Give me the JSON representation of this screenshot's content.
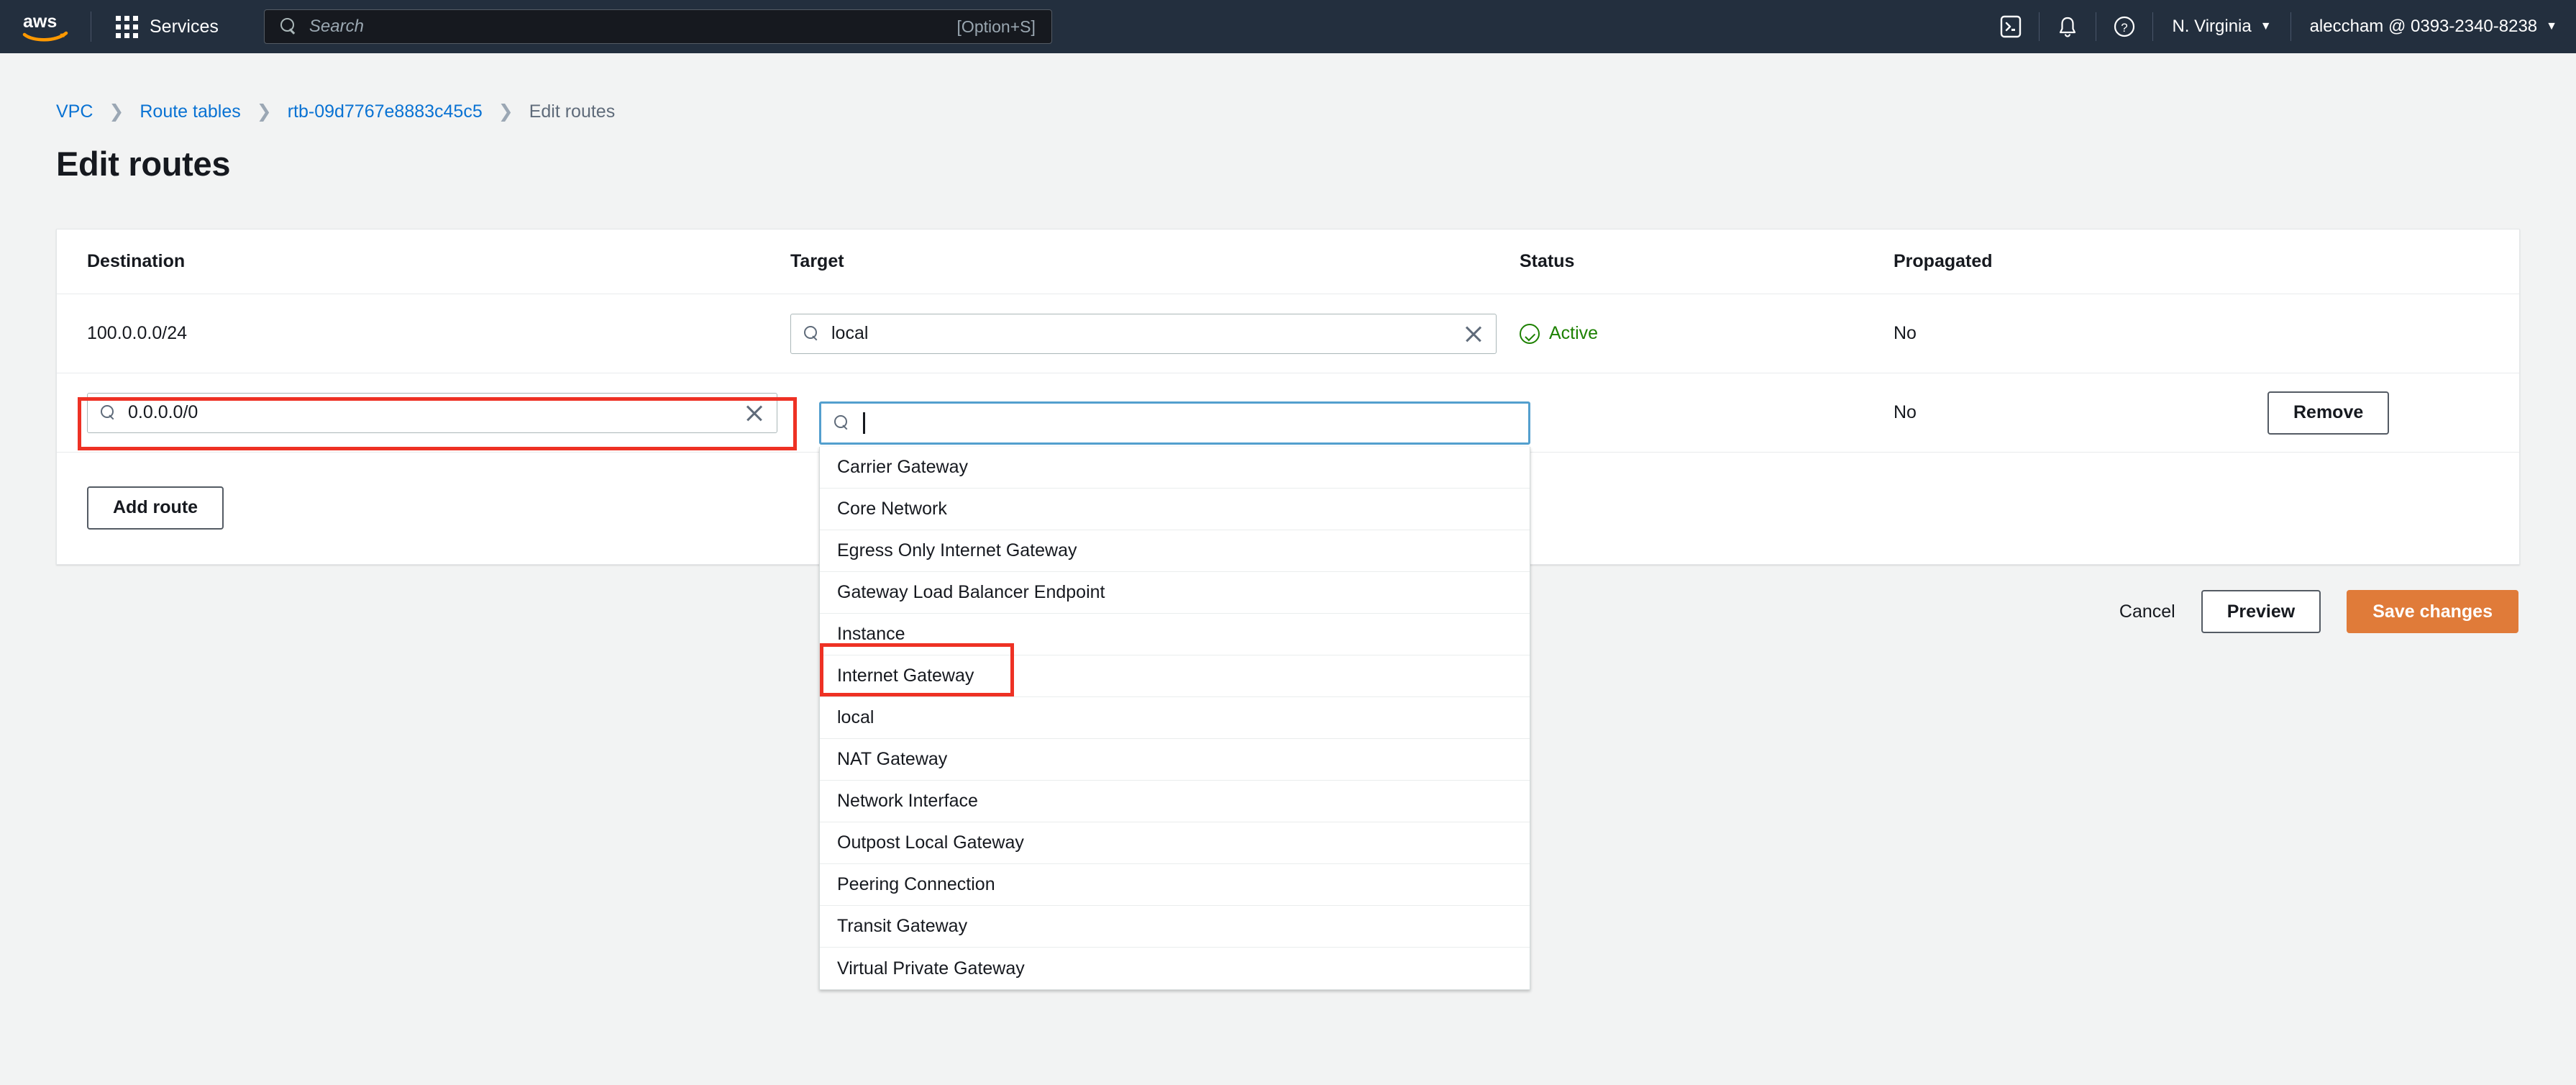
{
  "topnav": {
    "logo_alt": "aws",
    "services_label": "Services",
    "search": {
      "placeholder": "Search",
      "shortcut": "[Option+S]"
    },
    "cloudshell_icon": "cloudshell-icon",
    "notifications_icon": "bell-icon",
    "help_icon": "question-mark-icon",
    "region": "N. Virginia",
    "account": "aleccham @ 0393-2340-8238",
    "caret": "▼"
  },
  "breadcrumb": {
    "items": [
      {
        "label": "VPC",
        "current": false
      },
      {
        "label": "Route tables",
        "current": false
      },
      {
        "label": "rtb-09d7767e8883c45c5",
        "current": false
      },
      {
        "label": "Edit routes",
        "current": true
      }
    ],
    "separator": "❯"
  },
  "page": {
    "title": "Edit routes"
  },
  "table": {
    "columns": [
      "Destination",
      "Target",
      "Status",
      "Propagated"
    ],
    "rows": [
      {
        "destination": "100.0.0.0/24",
        "target_value": "local",
        "status": "Active",
        "status_type": "active",
        "propagated": "No",
        "action": null
      },
      {
        "destination": "0.0.0.0/0",
        "target_value": "",
        "status": "–",
        "status_type": "none",
        "propagated": "No",
        "action": "Remove"
      }
    ],
    "add_route_label": "Add route"
  },
  "target_dropdown": {
    "input_value": "",
    "open": true,
    "options": [
      "Carrier Gateway",
      "Core Network",
      "Egress Only Internet Gateway",
      "Gateway Load Balancer Endpoint",
      "Instance",
      "Internet Gateway",
      "local",
      "NAT Gateway",
      "Network Interface",
      "Outpost Local Gateway",
      "Peering Connection",
      "Transit Gateway",
      "Virtual Private Gateway"
    ],
    "highlighted_option": "Internet Gateway"
  },
  "footer": {
    "cancel_label": "Cancel",
    "preview_label": "Preview",
    "save_label": "Save changes"
  },
  "colors": {
    "nav_background": "#232f3e",
    "link": "#0972d3",
    "primary_button": "#e07b39",
    "annotation": "#ee3124",
    "focus_border": "#539fce",
    "status_active": "#1d8102",
    "page_background": "#f2f3f3"
  }
}
